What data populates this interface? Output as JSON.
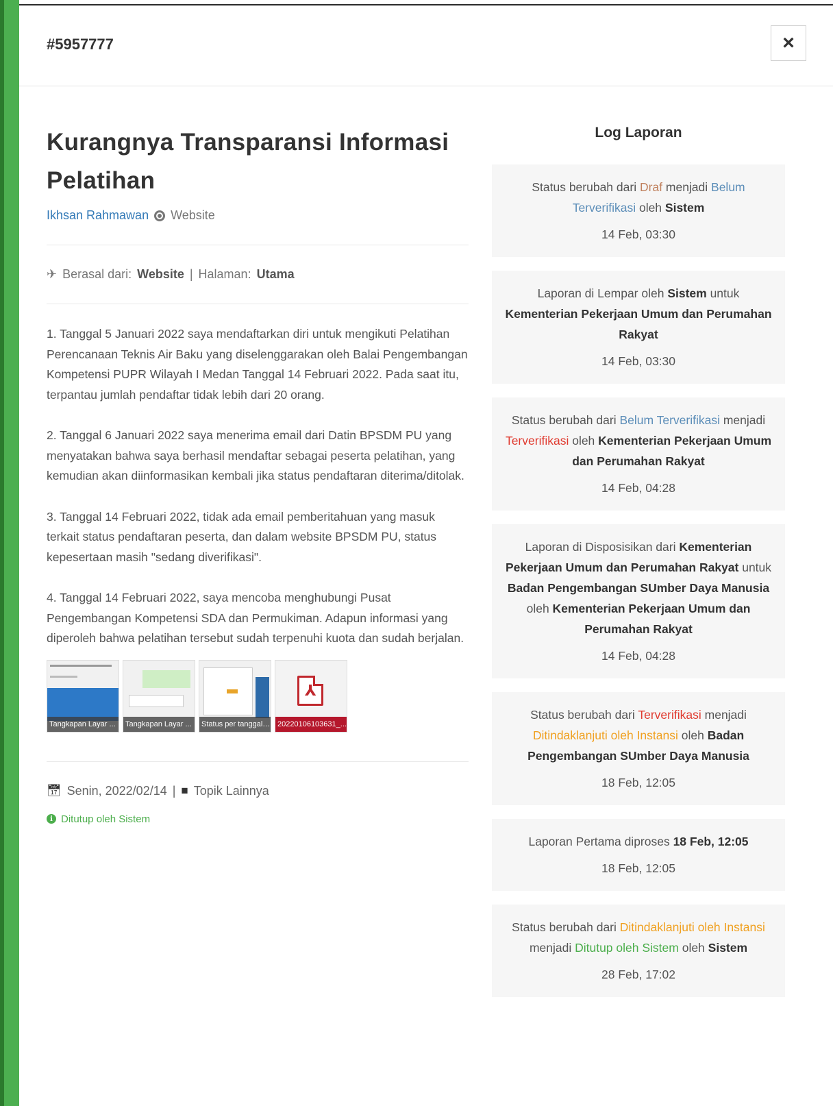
{
  "header": {
    "ticket_id": "#5957777",
    "close_label": "×"
  },
  "report": {
    "title": "Kurangnya Transparansi Informasi Pelatihan",
    "author": "Ikhsan Rahmawan",
    "channel": "Website",
    "origin_label": "Berasal dari:",
    "origin_value": "Website",
    "page_label": "Halaman:",
    "page_value": "Utama",
    "paragraphs": [
      "1. Tanggal 5 Januari 2022 saya mendaftarkan diri untuk mengikuti Pelatihan Perencanaan Teknis Air Baku yang diselenggarakan oleh Balai Pengembangan Kompetensi PUPR Wilayah I Medan Tanggal 14 Februari 2022. Pada saat itu, terpantau jumlah pendaftar tidak lebih dari 20 orang.",
      "2. Tanggal 6 Januari 2022 saya menerima email dari Datin BPSDM PU yang menyatakan bahwa saya berhasil mendaftar sebagai peserta pelatihan, yang kemudian akan diinformasikan kembali jika status pendaftaran diterima/ditolak.",
      "3. Tanggal 14 Februari 2022, tidak ada email pemberitahuan yang masuk terkait status pendaftaran peserta, dan dalam website BPSDM PU, status kepesertaan masih \"sedang diverifikasi\".",
      "4. Tanggal 14 Februari 2022, saya mencoba menghubungi Pusat Pengembangan Kompetensi SDA dan Permukiman. Adapun informasi yang diperoleh bahwa pelatihan tersebut sudah terpenuhi kuota dan sudah berjalan."
    ],
    "attachments": [
      {
        "caption": "Tangkapan Layar ..."
      },
      {
        "caption": "Tangkapan Layar ..."
      },
      {
        "caption": "Status per tanggal ..."
      },
      {
        "caption": "20220106103631_..."
      }
    ],
    "date": "Senin, 2022/02/14",
    "topic": "Topik Lainnya",
    "closed_status": "Ditutup oleh Sistem"
  },
  "log": {
    "title": "Log Laporan",
    "entries": [
      {
        "t1": "Status berubah dari ",
        "s1": "Draf",
        "t2": " menjadi ",
        "s2": "Belum Terverifikasi",
        "t3": " oleh ",
        "b1": "Sistem",
        "time": "14 Feb, 03:30"
      },
      {
        "t1": "Laporan di Lempar oleh ",
        "b1": "Sistem",
        "t2": " untuk ",
        "b2": "Kementerian Pekerjaan Umum dan Perumahan Rakyat",
        "time": "14 Feb, 03:30"
      },
      {
        "t1": "Status berubah dari ",
        "s1": "Belum Terverifikasi",
        "t2": " menjadi ",
        "s2": "Terverifikasi",
        "t3": " oleh ",
        "b1": "Kementerian Pekerjaan Umum dan Perumahan Rakyat",
        "time": "14 Feb, 04:28"
      },
      {
        "t1": "Laporan di Disposisikan dari ",
        "b1": "Kementerian Pekerjaan Umum dan Perumahan Rakyat",
        "t2": " untuk ",
        "b2": "Badan Pengembangan SUmber Daya Manusia",
        "t3": " oleh ",
        "b3": "Kementerian Pekerjaan Umum dan Perumahan Rakyat",
        "time": "14 Feb, 04:28"
      },
      {
        "t1": "Status berubah dari ",
        "s1": "Terverifikasi",
        "t2": " menjadi ",
        "s2": "Ditindaklanjuti oleh Instansi",
        "t3": " oleh ",
        "b1": "Badan Pengembangan SUmber Daya Manusia",
        "time": "18 Feb, 12:05"
      },
      {
        "t1": "Laporan Pertama diproses ",
        "b1": "18 Feb, 12:05",
        "time": "18 Feb, 12:05"
      },
      {
        "t1": "Status berubah dari ",
        "s1": "Ditindaklanjuti oleh Instansi",
        "t2": " menjadi ",
        "s2": "Ditutup oleh Sistem",
        "t3": " oleh ",
        "b1": "Sistem",
        "time": "28 Feb, 17:02"
      }
    ]
  },
  "colors": {
    "accent_bar": "#4caf50",
    "link": "#337ab7",
    "status_draf": "#c0815e",
    "status_belum": "#5b8db8",
    "status_verified": "#e03a2f",
    "status_followup": "#f0a020",
    "status_closed": "#4cae4c"
  }
}
